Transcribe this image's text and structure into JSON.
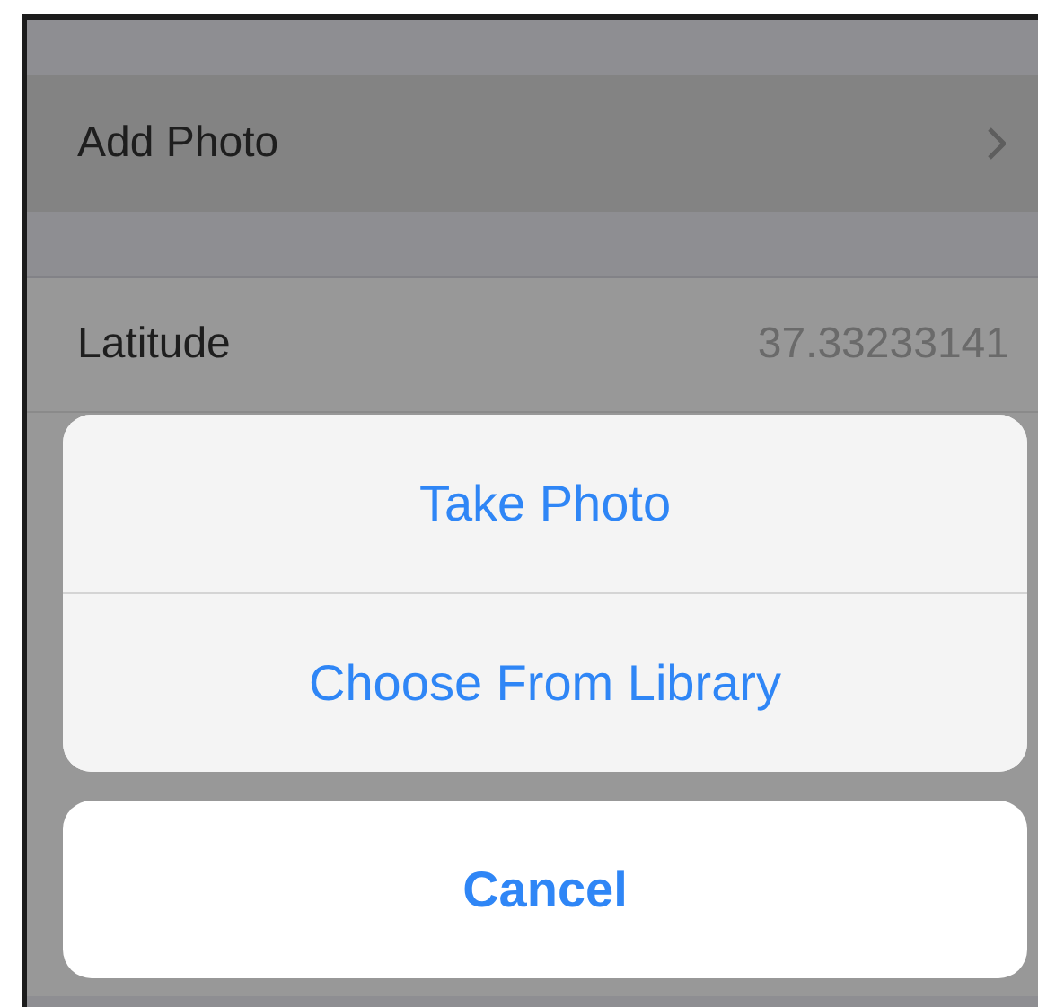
{
  "photo_row": {
    "label": "Add Photo"
  },
  "rows": [
    {
      "label": "Latitude",
      "value": "37.33233141"
    }
  ],
  "action_sheet": {
    "actions": [
      "Take Photo",
      "Choose From Library"
    ],
    "cancel": "Cancel"
  }
}
